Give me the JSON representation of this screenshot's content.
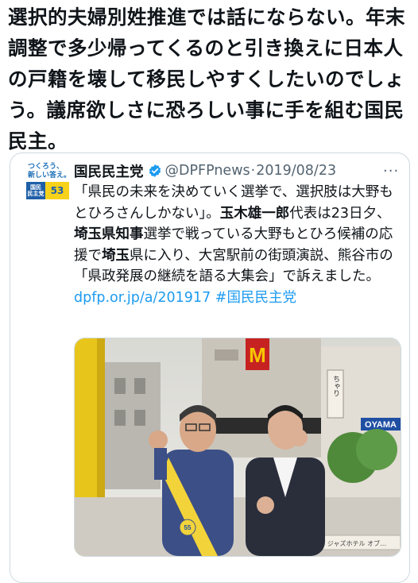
{
  "main_text": "選択的夫婦別姓推進では話にならない。年末調整で多少帰ってくるのと引き換えに日本人の戸籍を壊して移民しやすくしたいのでしょう。議席欲しさに恐ろしい事に手を組む国民民主。",
  "quoted": {
    "avatar": {
      "slogan": "つくろう、\n新しい答え。",
      "logo_left": "国民\n民主党",
      "logo_right": "53"
    },
    "name": "国民民主党",
    "handle": "@DPFPnews",
    "separator": "·",
    "date": "2019/08/23",
    "more": "···",
    "body": {
      "t1": "「県民の未来を決めていく選挙で、選択肢は大野もとひろさんしかない」。",
      "b1": "玉木雄一郎",
      "t2": "代表は23日夕、",
      "b2": "埼玉県知事",
      "t3": "選挙で戦っている大野もとひろ候補の応援で",
      "b3": "埼玉",
      "t4": "県に入り、大宮駅前の街頭演説、熊谷市の「県政発展の継続を語る大集会」で訴えました。",
      "link": "dpfp.or.jp/a/201917",
      "hashtag": "#国民民主党"
    },
    "photo": {
      "sign_left": "ちゃり",
      "sign_right": "OYAMA",
      "sign_bottom": "ジャズホテル オブ…",
      "sash": "55",
      "logo_letter": "M"
    }
  },
  "colors": {
    "link": "#1d9bf0",
    "verified": "#1d9bf0",
    "muted": "#536471",
    "border": "#cfd9de"
  }
}
